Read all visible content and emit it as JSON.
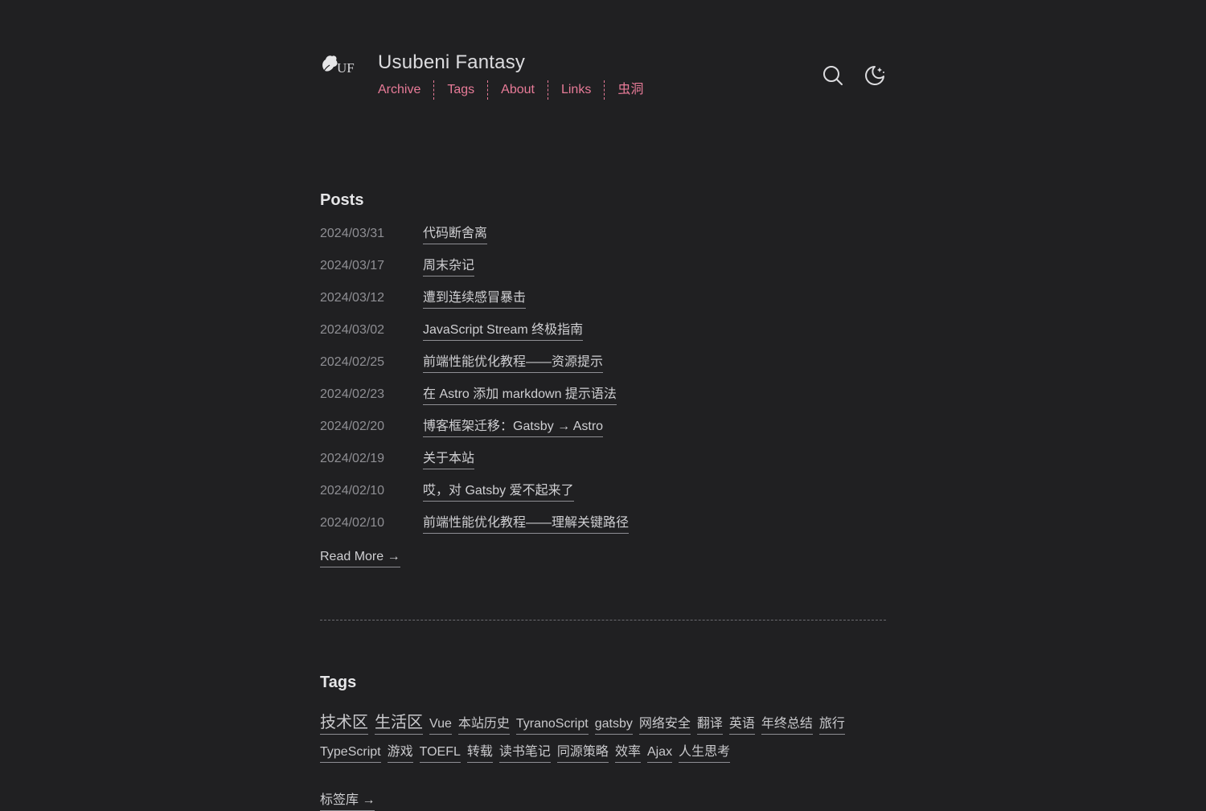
{
  "header": {
    "logo_text": "UF",
    "title": "Usubeni Fantasy",
    "nav": [
      "Archive",
      "Tags",
      "About",
      "Links",
      "虫洞"
    ],
    "search_icon": "search-icon",
    "theme_icon": "moon-icon"
  },
  "posts": {
    "heading": "Posts",
    "items": [
      {
        "date": "2024/03/31",
        "title": "代码断舍离"
      },
      {
        "date": "2024/03/17",
        "title": "周末杂记"
      },
      {
        "date": "2024/03/12",
        "title": "遭到连续感冒暴击"
      },
      {
        "date": "2024/03/02",
        "title": "JavaScript Stream 终极指南"
      },
      {
        "date": "2024/02/25",
        "title": "前端性能优化教程——资源提示"
      },
      {
        "date": "2024/02/23",
        "title": "在 Astro 添加 markdown 提示语法"
      },
      {
        "date": "2024/02/20",
        "title": "博客框架迁移：Gatsby → Astro"
      },
      {
        "date": "2024/02/19",
        "title": "关于本站"
      },
      {
        "date": "2024/02/10",
        "title": "哎，对 Gatsby 爱不起来了"
      },
      {
        "date": "2024/02/10",
        "title": "前端性能优化教程——理解关键路径"
      }
    ],
    "read_more": "Read More →"
  },
  "tags": {
    "heading": "Tags",
    "items": [
      {
        "label": "技术区",
        "size": "big"
      },
      {
        "label": "生活区",
        "size": "big"
      },
      {
        "label": "Vue"
      },
      {
        "label": "本站历史"
      },
      {
        "label": "TyranoScript"
      },
      {
        "label": "gatsby"
      },
      {
        "label": "网络安全"
      },
      {
        "label": "翻译"
      },
      {
        "label": "英语"
      },
      {
        "label": "年终总结"
      },
      {
        "label": "旅行"
      },
      {
        "label": "TypeScript"
      },
      {
        "label": "游戏"
      },
      {
        "label": "TOEFL"
      },
      {
        "label": "转载"
      },
      {
        "label": "读书笔记"
      },
      {
        "label": "同源策略"
      },
      {
        "label": "效率"
      },
      {
        "label": "Ajax"
      },
      {
        "label": "人生思考"
      }
    ],
    "more": "标签库 →"
  },
  "colors": {
    "background": "#202022",
    "accent": "#e87b98",
    "text": "#c9c9cc",
    "muted": "#8f8f94"
  }
}
